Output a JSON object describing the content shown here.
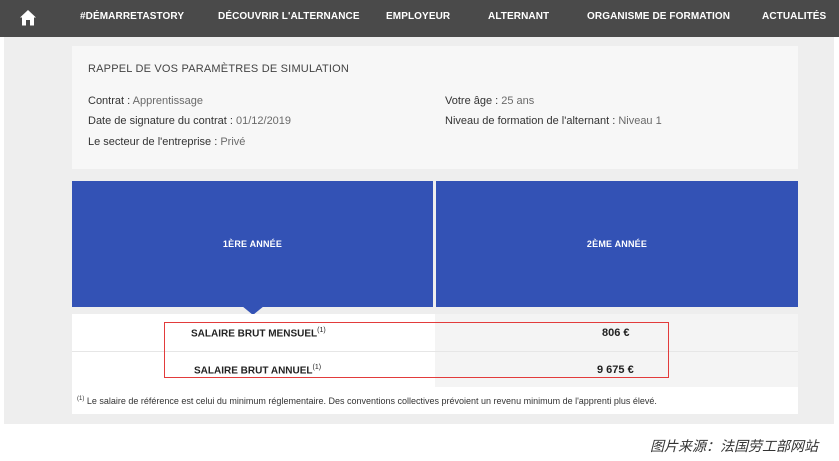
{
  "nav": {
    "items": [
      {
        "label": "#DÉMARRETASTORY"
      },
      {
        "label": "DÉCOUVRIR L'ALTERNANCE"
      },
      {
        "label": "EMPLOYEUR"
      },
      {
        "label": "ALTERNANT"
      },
      {
        "label": "ORGANISME DE FORMATION"
      },
      {
        "label": "ACTUALITÉS"
      }
    ],
    "home_icon": "home-icon"
  },
  "params": {
    "title": "RAPPEL DE VOS PARAMÈTRES DE SIMULATION",
    "contrat_label": "Contrat : ",
    "contrat_value": "Apprentissage",
    "date_label": "Date de signature du contrat : ",
    "date_value": "01/12/2019",
    "secteur_label": "Le secteur de l'entreprise : ",
    "secteur_value": "Privé",
    "age_label": "Votre âge : ",
    "age_value": "25 ans",
    "niveau_label": "Niveau de formation de l'alternant : ",
    "niveau_value": "Niveau 1"
  },
  "years": {
    "year1": "1ÈRE ANNÉE",
    "year2": "2ÈME ANNÉE"
  },
  "salary": {
    "monthly_label": "SALAIRE BRUT MENSUEL",
    "monthly_value": "806 €",
    "annual_label": "SALAIRE BRUT ANNUEL",
    "annual_value": "9 675 €",
    "note_marker": "(1)"
  },
  "footnote": {
    "marker": "(1)",
    "text": " Le salaire de référence est celui du minimum réglementaire. Des conventions collectives prévoient un revenu minimum de l'apprenti plus élevé."
  },
  "caption": "图片来源：法国劳工部网站",
  "colors": {
    "nav_bg": "#4a4a4a",
    "accent_blue": "#3352b5",
    "highlight_red": "#e23b3b"
  }
}
